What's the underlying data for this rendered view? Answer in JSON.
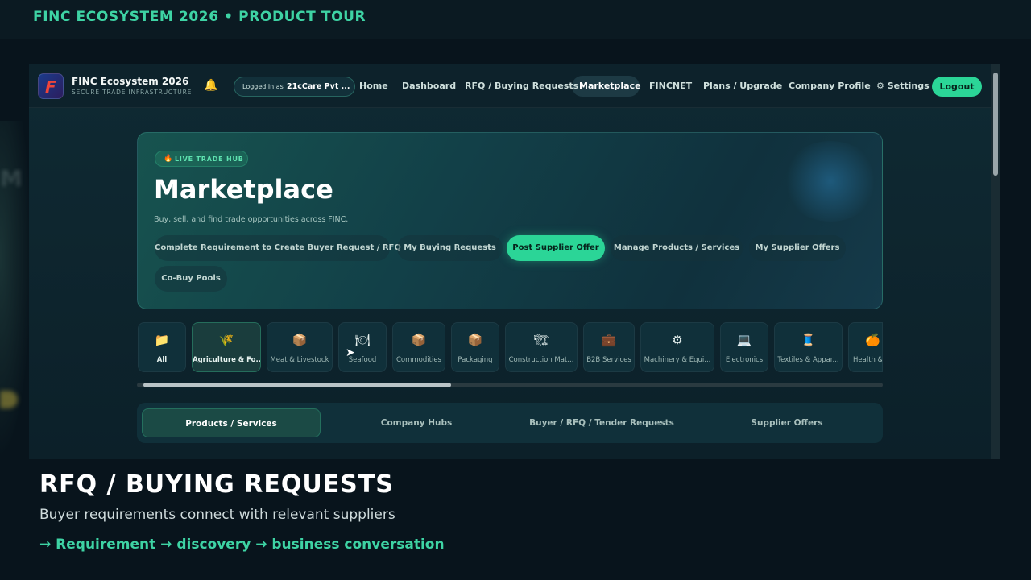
{
  "tour": {
    "title": "FINC ECOSYSTEM 2026  •  PRODUCT TOUR"
  },
  "app": {
    "logo_letter": "F",
    "name": "FINC Ecosystem 2026",
    "tagline": "SECURE TRADE INFRASTRUCTURE",
    "bell_icon": "bell-icon",
    "login": {
      "label": "Logged in as",
      "company": "21cCare Pvt ..."
    },
    "nav": [
      "Home",
      "Dashboard",
      "RFQ / Buying Requests",
      "Marketplace",
      "FINCNET",
      "Plans / Upgrade",
      "Company Profile",
      "⚙ Settings"
    ],
    "active_nav": "Marketplace",
    "logout_label": "Logout"
  },
  "hero": {
    "badge_icon": "🔥",
    "badge": "LIVE TRADE HUB",
    "title": "Marketplace",
    "subtitle": "Buy, sell, and find trade opportunities across FINC.",
    "actions": [
      "Complete Requirement to Create Buyer Request / RFQ",
      "My Buying Requests",
      "Post Supplier Offer",
      "Manage Products / Services",
      "My Supplier Offers",
      "Co-Buy Pools"
    ],
    "primary_action": "Post Supplier Offer"
  },
  "categories": [
    {
      "icon": "📁",
      "label": "All"
    },
    {
      "icon": "🌾",
      "label": "Agriculture & Fo..."
    },
    {
      "icon": "📦",
      "label": "Meat & Livestock"
    },
    {
      "icon": "🍽",
      "label": "Seafood"
    },
    {
      "icon": "📦",
      "label": "Commodities"
    },
    {
      "icon": "📦",
      "label": "Packaging"
    },
    {
      "icon": "🏗",
      "label": "Construction Mat..."
    },
    {
      "icon": "💼",
      "label": "B2B Services"
    },
    {
      "icon": "⚙",
      "label": "Machinery & Equi..."
    },
    {
      "icon": "💻",
      "label": "Electronics"
    },
    {
      "icon": "🧵",
      "label": "Textiles & Appar..."
    },
    {
      "icon": "🍊",
      "label": "Health &..."
    }
  ],
  "selected_category": "Agriculture & Fo...",
  "tabs": [
    "Products / Services",
    "Company Hubs",
    "Buyer / RFQ / Tender Requests",
    "Supplier Offers"
  ],
  "active_tab": "Products / Services",
  "caption": {
    "title": "RFQ / BUYING REQUESTS",
    "subtitle": "Buyer requirements connect with relevant suppliers",
    "flow": "→  Requirement  →  discovery  →  business conversation"
  },
  "colors": {
    "accent": "#2bd597",
    "accent_text": "#3ed3a4",
    "background": "#08141c"
  }
}
